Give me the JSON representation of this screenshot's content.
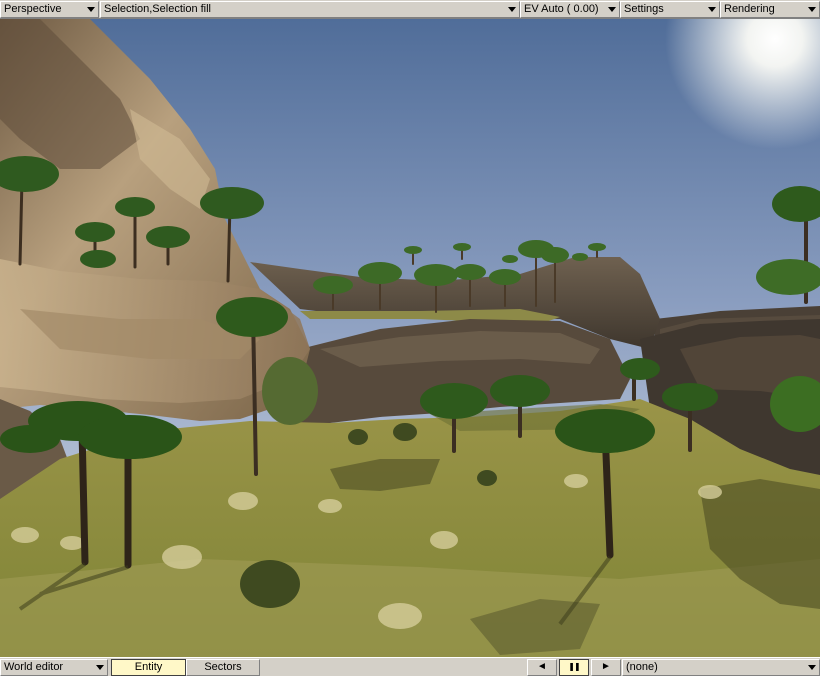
{
  "toolbar": {
    "view_mode": "Perspective",
    "selection_mode": "Selection,Selection fill",
    "exposure": "EV Auto ( 0.00)",
    "settings": "Settings",
    "rendering": "Rendering"
  },
  "status_bar": {
    "editor_mode": "World editor",
    "tabs": [
      {
        "label": "Entity",
        "active": true
      },
      {
        "label": "Sectors",
        "active": false
      }
    ],
    "playback": {
      "prev": "◄",
      "pause": "❚❚",
      "next": "►",
      "paused": true
    },
    "selection_value": "(none)"
  },
  "icons": {
    "dropdown": "chevron-down-icon",
    "prev": "step-back-icon",
    "pause": "pause-icon",
    "next": "step-forward-icon"
  },
  "colors": {
    "ui_face": "#d4d0c8",
    "active_tab": "#fff8c8",
    "sky_top": "#4e6c98",
    "sky_horizon": "#dfe3ea",
    "grass": "#8c8f3c"
  }
}
